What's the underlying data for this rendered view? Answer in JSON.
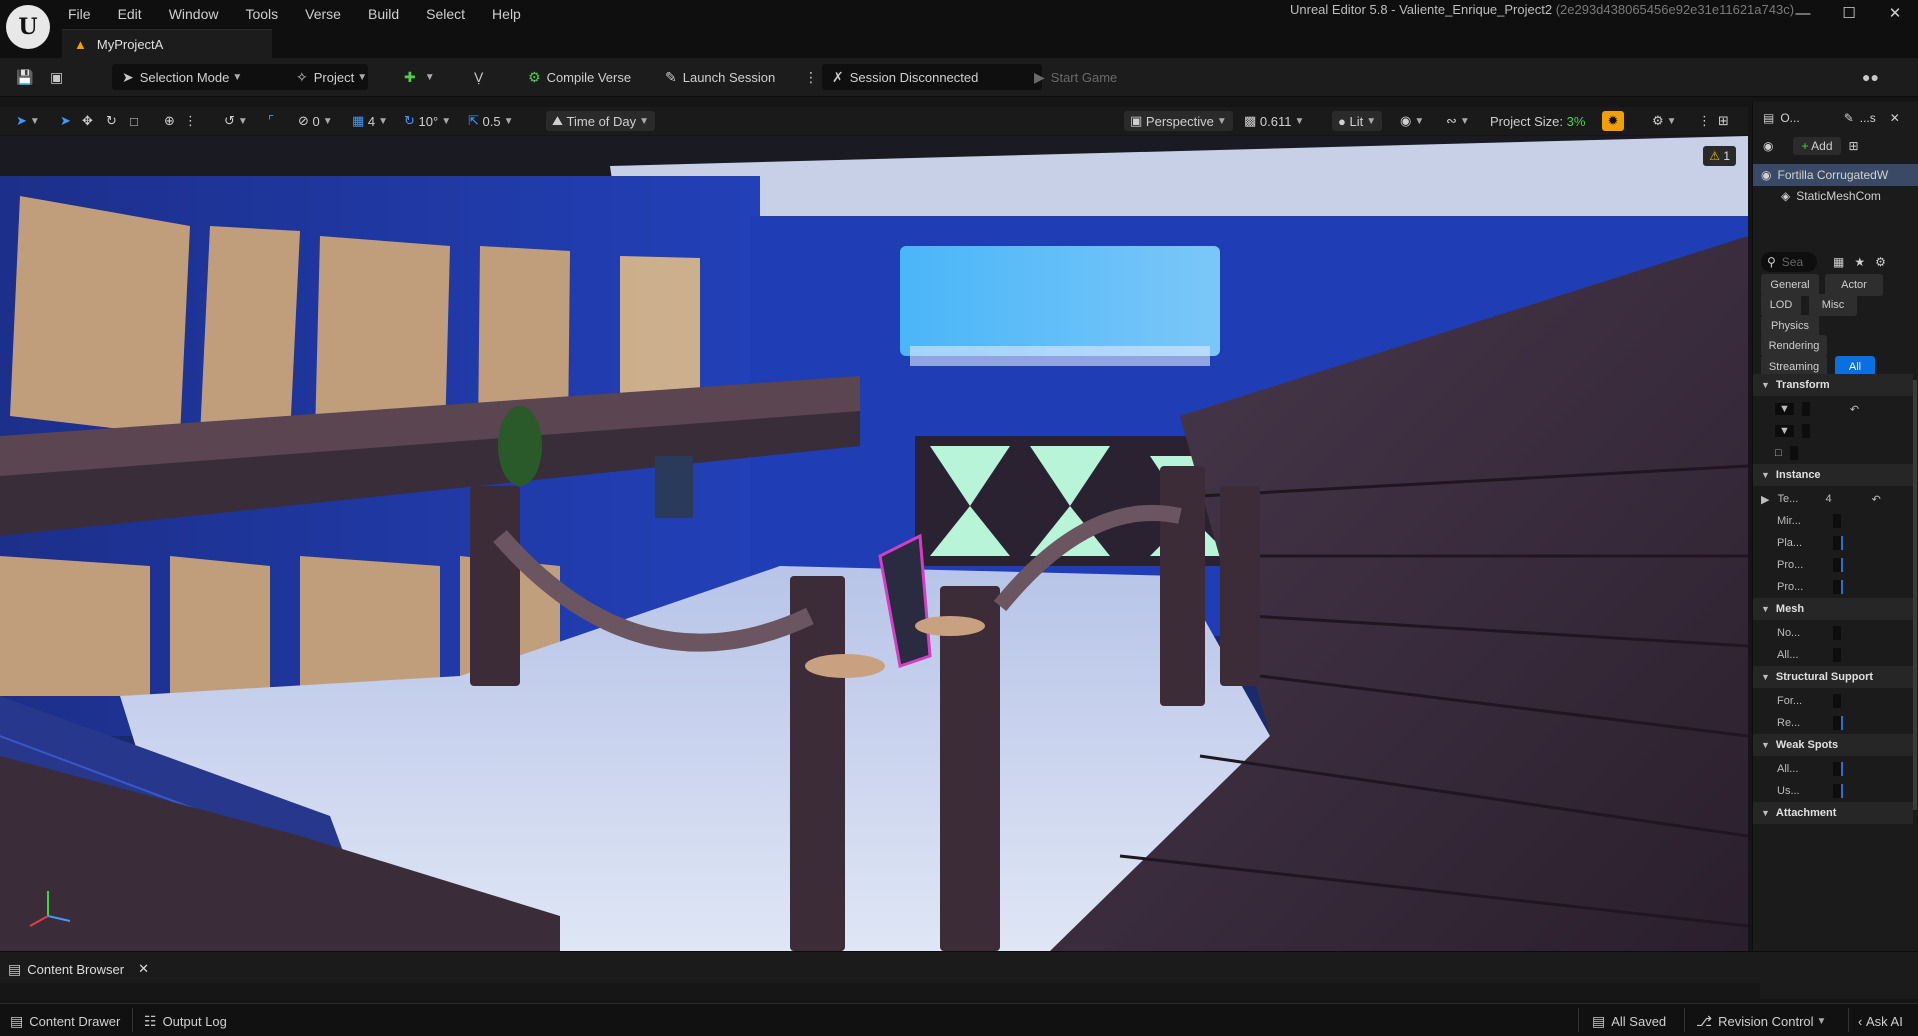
{
  "app": {
    "title_main": "Unreal Editor 5.8 - Valiente_Enrique_Project2",
    "title_hash": "(2e293d438065456e92e31e11621a743c)",
    "project_tab": "MyProjectA"
  },
  "menu": [
    "File",
    "Edit",
    "Window",
    "Tools",
    "Verse",
    "Build",
    "Select",
    "Help"
  ],
  "toolbar": {
    "selection_mode": "Selection Mode",
    "project": "Project",
    "compile_verse": "Compile Verse",
    "launch_session": "Launch Session",
    "session_status": "Session Disconnected",
    "start_game": "Start Game"
  },
  "viewport_toolbar": {
    "rotate_snap_count": "0",
    "grid_snap": "4",
    "angle_snap": "10°",
    "scale_snap": "0.5",
    "time_of_day": "Time of Day",
    "perspective": "Perspective",
    "camera_speed": "0.611",
    "lit": "Lit",
    "project_size_label": "Project Size:",
    "project_size_value": "3%",
    "warning_count": "1"
  },
  "outliner": {
    "tab1": "O...",
    "tab2": "...s",
    "add_label": "Add",
    "selected_actor": "Fortilla CorrugatedW",
    "component": "StaticMeshCom"
  },
  "details": {
    "search_placeholder": "Sea",
    "categories": [
      "General",
      "Actor",
      "LOD",
      "Misc",
      "Physics",
      "Rendering",
      "Streaming",
      "All"
    ],
    "sections": {
      "transform": "Transform",
      "instance": "Instance",
      "mesh": "Mesh",
      "structural": "Structural Support",
      "weak_spots": "Weak Spots",
      "attachment": "Attachment"
    },
    "instance_props": [
      "Te...",
      "Mir...",
      "Pla...",
      "Pro...",
      "Pro..."
    ],
    "instance_te_value": "4",
    "mesh_props": [
      "No...",
      "All..."
    ],
    "structural_props": [
      "For...",
      "Re..."
    ],
    "weak_props": [
      "All...",
      "Us..."
    ]
  },
  "bottom": {
    "content_browser": "Content Browser",
    "content_drawer": "Content Drawer",
    "output_log": "Output Log",
    "all_saved": "All Saved",
    "revision_control": "Revision Control",
    "ask_ai": "Ask AI"
  },
  "colors": {
    "accent_blue": "#0a6fe0",
    "warning_orange": "#f0a000",
    "project_size_green": "#4ad14a"
  }
}
